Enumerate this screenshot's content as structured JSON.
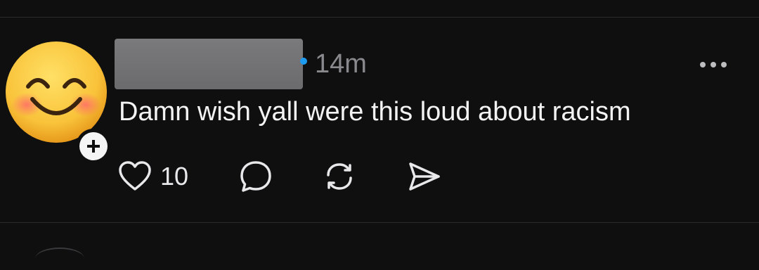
{
  "post": {
    "timestamp": "14m",
    "text": "Damn wish yall were this loud about racism",
    "like_count": "10"
  },
  "icons": {
    "avatar": "smiling-face-emoji",
    "follow": "plus-icon",
    "like": "heart-icon",
    "reply": "speech-bubble-icon",
    "repost": "repost-icon",
    "share": "send-icon",
    "more": "more-dots-icon",
    "verified": "verified-badge-icon"
  },
  "colors": {
    "background": "#0f0f10",
    "text": "#f3f3f3",
    "muted": "#8a8a8e",
    "verified": "#1d9bf0",
    "redaction": "#6e6e70"
  }
}
